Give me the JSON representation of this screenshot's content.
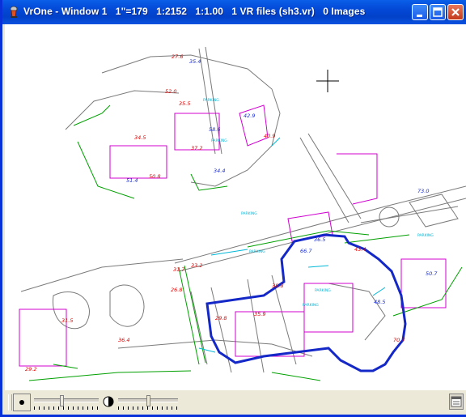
{
  "window": {
    "title": "VrOne - Window 1   1\"=179   1:2152   1:1.00   1 VR files (sh3.vr)   0 Images",
    "icon": "vrone-app-icon",
    "controls": {
      "minimize": "minimize-icon",
      "maximize": "maximize-icon",
      "close": "close-icon"
    }
  },
  "map": {
    "cursor": "crosshair-icon",
    "labels": [
      "27.6",
      "35.4",
      "52.0",
      "35.5",
      "34.5",
      "58.6",
      "37.2",
      "50.8",
      "42.9",
      "40.9",
      "34.4",
      "51.4",
      "38.8",
      "31.7",
      "36.5",
      "26.8",
      "29.2",
      "50.7",
      "66.7",
      "73.0",
      "43.4",
      "48.5",
      "70.7",
      "33.2",
      "36.4",
      "29.8",
      "35.9",
      "31.5"
    ],
    "tags": [
      "PARKING",
      "PARKING",
      "PARKING",
      "PARKING",
      "PARKING",
      "PARKING",
      "PARKING"
    ],
    "colors": {
      "boundary": "#1428c8",
      "red_text": "#e00000",
      "blue_text": "#1a2dd0",
      "magenta": "#d000d0",
      "green": "#00a000",
      "gray": "#7a7a7a",
      "cyan": "#00b8d8"
    }
  },
  "toolbar": {
    "left_button_icon": "zoom-box-icon",
    "zoom_slider_value": 0.43,
    "brightness_icon": "contrast-icon",
    "brightness_slider_value": 0.5,
    "right_button_icon": "panel-icon"
  }
}
